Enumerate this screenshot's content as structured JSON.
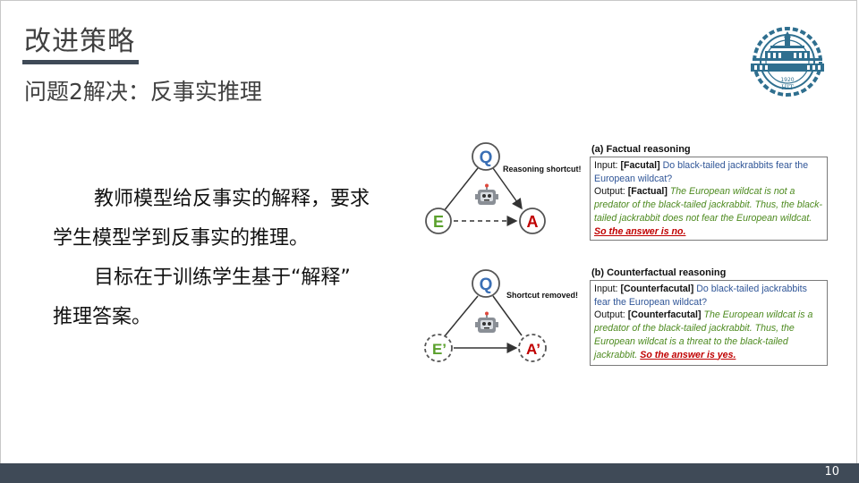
{
  "slide": {
    "title": "改进策略",
    "subtitle": "问题2解决：反事实推理",
    "body": {
      "line1": "教师模型给反事实的解释，要求",
      "line2": "学生模型学到反事实的推理。",
      "line3": "目标在于训练学生基于“解释”",
      "line4": "推理答案。"
    },
    "page_number": "10",
    "logo": {
      "icon": "university-emblem-icon",
      "year": "1920",
      "letters": "HIT"
    }
  },
  "figure": {
    "factual": {
      "diagram": {
        "q": "Q",
        "e": "E",
        "a": "A",
        "note": "Reasoning shortcut!",
        "icon": "robot-icon"
      },
      "panel_title": "(a) Factual reasoning",
      "input_label": "Input:",
      "input_tag": "[Facutal]",
      "input_question": "Do black-tailed jackrabbits fear the European wildcat?",
      "output_label": "Output:",
      "output_tag": "[Factual]",
      "output_answer": "The European wildcat is not a predator of the black-tailed jackrabbit. Thus, the black-tailed jackrabbit does not fear the European wildcat.",
      "output_conclusion": "So the answer is no."
    },
    "counterfactual": {
      "diagram": {
        "q": "Q",
        "e": "E’",
        "a": "A’",
        "note": "Shortcut removed!",
        "icon": "robot-icon"
      },
      "panel_title": "(b) Counterfactual reasoning",
      "input_label": "Input:",
      "input_tag": "[Counterfacutal]",
      "input_question": "Do black-tailed jackrabbits fear the European wildcat?",
      "output_label": "Output:",
      "output_tag": "[Counterfacutal]",
      "output_answer": "The European wildcat is a predator of the black-tailed jackrabbit. Thus, the European wildcat is a threat to the black-tailed jackrabbit.",
      "output_conclusion": "So the answer is yes."
    }
  },
  "colors": {
    "footer": "#3f4a57",
    "blue_node": "#3a6fb5",
    "green_node": "#5aa02c",
    "red_node": "#c00000"
  }
}
